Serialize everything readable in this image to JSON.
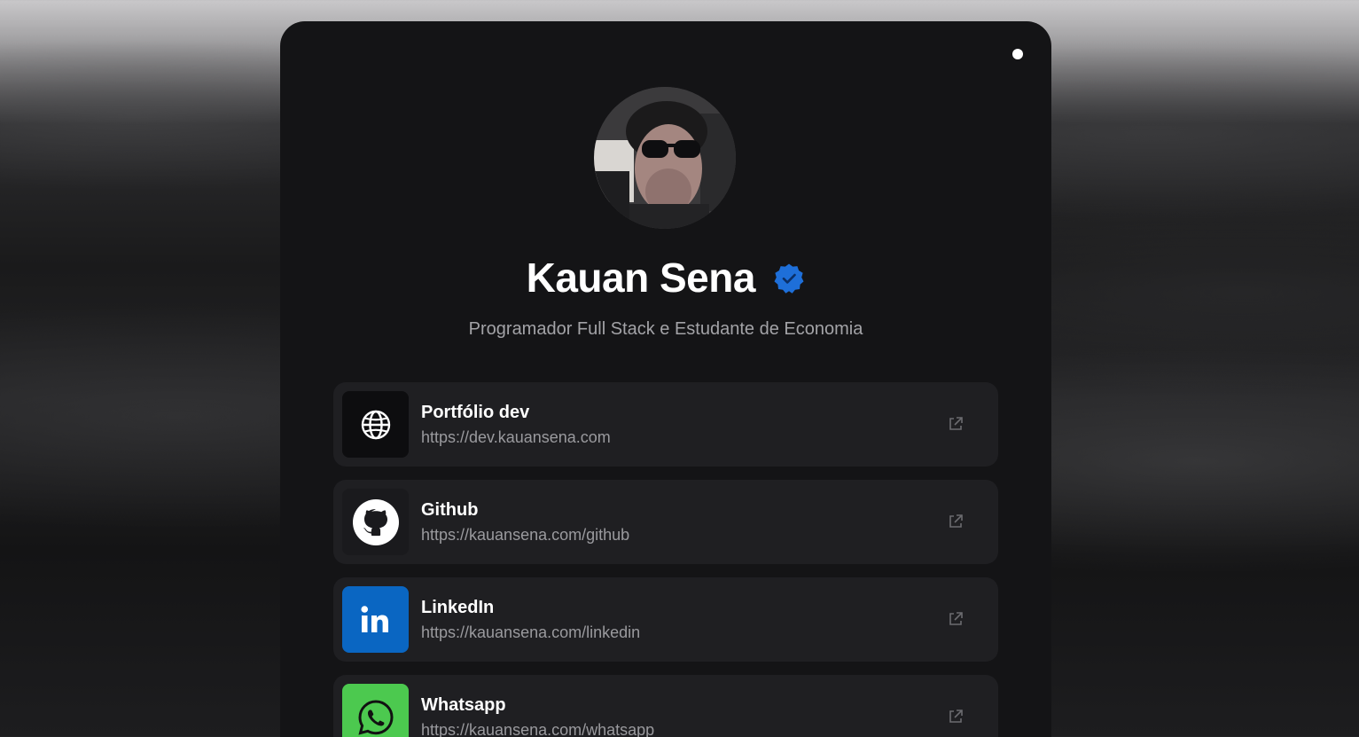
{
  "profile": {
    "name": "Kauan Sena",
    "subtitle": "Programador Full Stack e Estudante de Economia",
    "verified_badge_icon": "verified-badge-icon",
    "avatar_icon": "profile-photo",
    "status_indicator_icon": "status-dot-icon"
  },
  "links": [
    {
      "title": "Portfólio dev",
      "url": "https://dev.kauansena.com",
      "icon": "globe-icon",
      "icon_bg": "#0d0d0f"
    },
    {
      "title": "Github",
      "url": "https://kauansena.com/github",
      "icon": "github-icon",
      "icon_bg": "#1a1a1d"
    },
    {
      "title": "LinkedIn",
      "url": "https://kauansena.com/linkedin",
      "icon": "linkedin-icon",
      "icon_bg": "#0a66c2"
    },
    {
      "title": "Whatsapp",
      "url": "https://kauansena.com/whatsapp",
      "icon": "whatsapp-icon",
      "icon_bg": "#4cc94f"
    }
  ],
  "colors": {
    "card_bg": "#141416",
    "link_bg": "#1f1f22",
    "verified_blue": "#1e6fd9",
    "title_text": "#ffffff",
    "muted_text": "#9a9a9e"
  }
}
